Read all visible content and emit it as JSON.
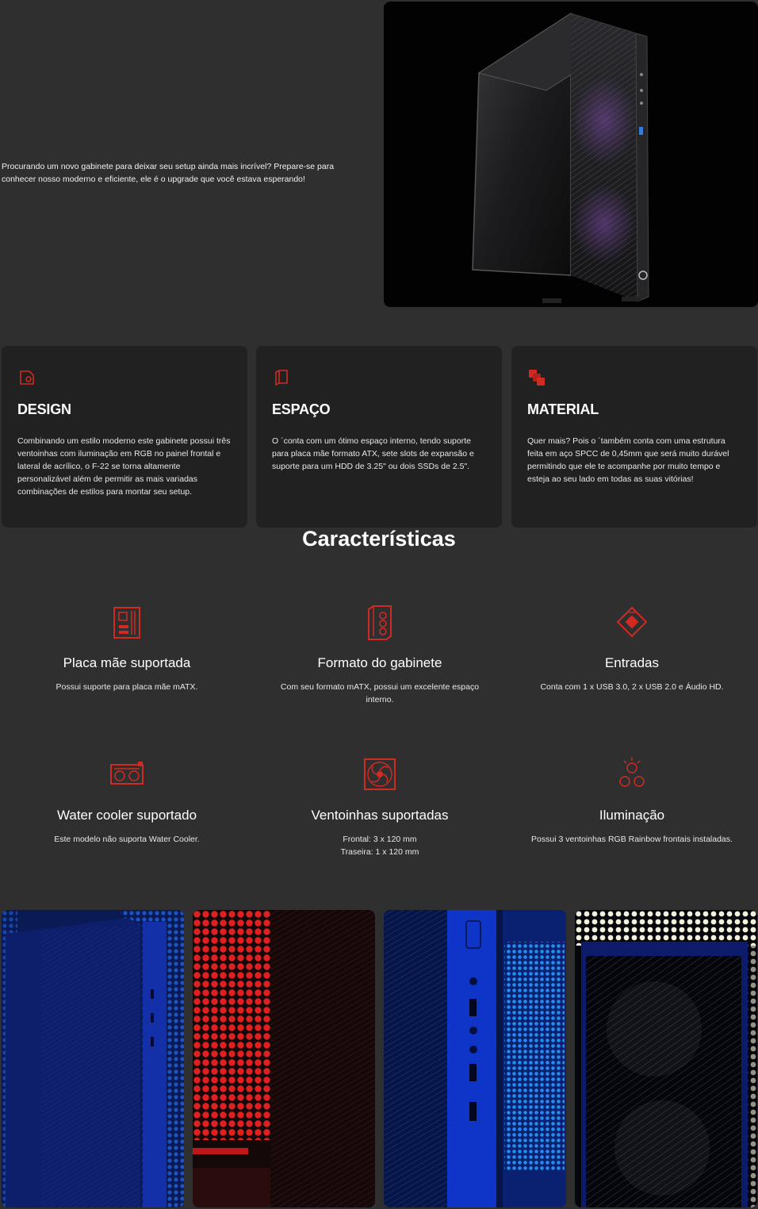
{
  "hero": {
    "description": "Procurando um novo gabinete para deixar seu setup ainda mais incrível? Prepare-se para conhecer nosso moderno e eficiente, ele é o upgrade que você estava esperando!"
  },
  "cards": [
    {
      "icon": "design-icon",
      "title": "DESIGN",
      "text": "Combinando um estilo moderno este gabinete possui três ventoinhas com iluminação em RGB no painel frontal e lateral de acrílico, o F-22 se torna altamente personalizável além de permitir as mais variadas combinações de estilos para montar seu setup."
    },
    {
      "icon": "space-icon",
      "title": "ESPAÇO",
      "text": "O ´conta com um ótimo espaço interno, tendo suporte para placa mãe formato ATX, sete slots de expansão e suporte para um HDD de 3.25\" ou dois SSDs de 2.5\"."
    },
    {
      "icon": "material-icon",
      "title": "MATERIAL",
      "text": "Quer mais? Pois o ´também conta com uma estrutura feita em aço SPCC de 0,45mm que será muito durável permitindo que ele te acompanhe por muito tempo e esteja ao seu lado em todas as suas vitórias!"
    }
  ],
  "features": {
    "title": "Características",
    "items": [
      {
        "icon": "motherboard-icon",
        "title": "Placa mãe suportada",
        "text": "Possui suporte para placa mãe mATX."
      },
      {
        "icon": "case-icon",
        "title": "Formato do gabinete",
        "text": "Com seu formato mATX, possui um excelente espaço interno."
      },
      {
        "icon": "usb-icon",
        "title": "Entradas",
        "text": "Conta com 1 x USB 3.0, 2 x USB 2.0 e Áudio HD."
      },
      {
        "icon": "water-cooler-icon",
        "title": "Water cooler suportado",
        "text": "Este modelo não suporta Water Cooler."
      },
      {
        "icon": "fan-icon",
        "title": "Ventoinhas suportadas",
        "text_lines": [
          "Frontal: 3 x 120 mm",
          "Traseira: 1 x 120 mm"
        ]
      },
      {
        "icon": "lighting-icon",
        "title": "Iluminação",
        "text": "Possui 3 ventoinhas RGB Rainbow frontais instaladas."
      }
    ]
  },
  "colors": {
    "background": "#2f2f30",
    "card": "#212122",
    "accent_red": "#d12a22"
  }
}
